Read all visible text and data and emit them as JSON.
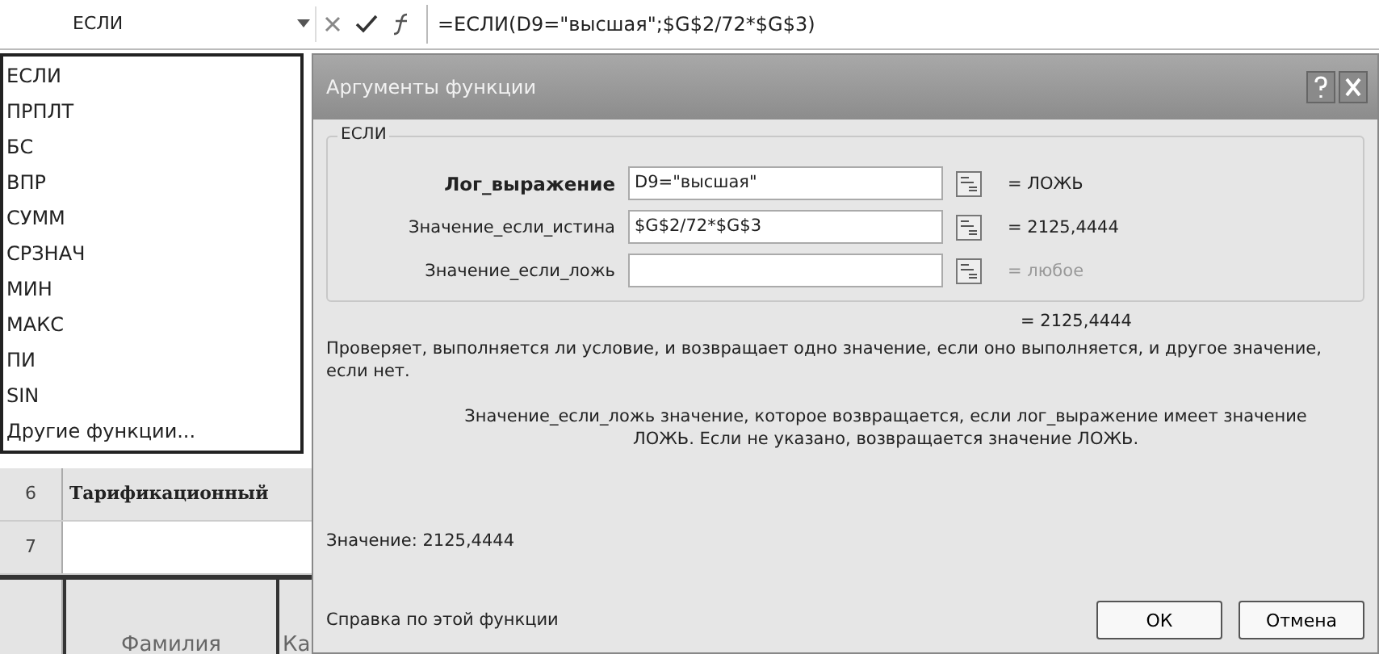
{
  "formula_bar": {
    "name_box": "ЕСЛИ",
    "formula": "=ЕСЛИ(D9=\"высшая\";$G$2/72*$G$3)"
  },
  "function_list": {
    "items": [
      "ЕСЛИ",
      "ПРПЛТ",
      "БС",
      "ВПР",
      "СУММ",
      "СРЗНАЧ",
      "МИН",
      "МАКС",
      "ПИ",
      "SIN",
      "Другие функции..."
    ]
  },
  "sheet": {
    "rows": [
      {
        "header": "6",
        "cell": "Тарификационный"
      },
      {
        "header": "7"
      }
    ],
    "table_headers": [
      "Фамилия",
      "Ка"
    ]
  },
  "dialog": {
    "title": "Аргументы функции",
    "group": "ЕСЛИ",
    "arguments": [
      {
        "label": "Лог_выражение",
        "value": "D9=\"высшая\"",
        "result": "= ЛОЖЬ",
        "empty": false
      },
      {
        "label": "Значение_если_истина",
        "value": "$G$2/72*$G$3",
        "result": "= 2125,4444",
        "empty": false
      },
      {
        "label": "Значение_если_ложь",
        "result": "= любое",
        "empty": true
      }
    ],
    "total": "= 2125,4444",
    "description": "Проверяет, выполняется ли условие, и возвращает одно значение, если оно выполняется, и другое значение, если нет.",
    "arg_help": "Значение_если_ложь  значение, которое возвращается, если лог_выражение имеет значение ЛОЖЬ. Если не указано, возвращается значение ЛОЖЬ.",
    "value_line": "Значение: 2125,4444",
    "help_link": "Справка по этой функции",
    "buttons": [
      "ОК",
      "Отмена"
    ]
  }
}
